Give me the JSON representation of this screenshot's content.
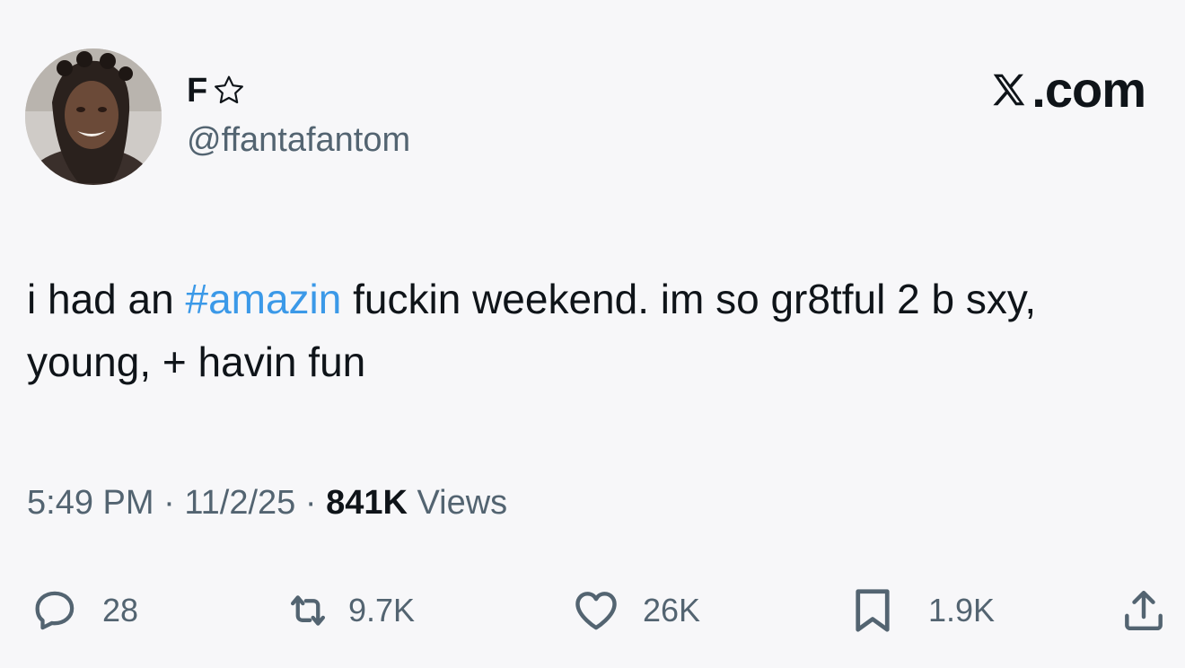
{
  "user": {
    "display_name": "F",
    "handle": "@ffantafantom"
  },
  "source": {
    "brand_text": ".com"
  },
  "tweet": {
    "text_before": "i had an ",
    "hashtag": "#amazin",
    "text_after": " fuckin weekend. im so gr8tful 2 b sxy, young, + havin fun"
  },
  "meta": {
    "time": "5:49 PM",
    "sep1": " · ",
    "date": "11/2/25",
    "sep2": " · ",
    "views_count": "841K",
    "views_label": " Views"
  },
  "actions": {
    "replies": "28",
    "reposts": "9.7K",
    "likes": "26K",
    "bookmarks": "1.9K"
  },
  "colors": {
    "background": "#f7f7f9",
    "text": "#0f1419",
    "secondary": "#536471",
    "hashtag": "#3b99e8"
  }
}
